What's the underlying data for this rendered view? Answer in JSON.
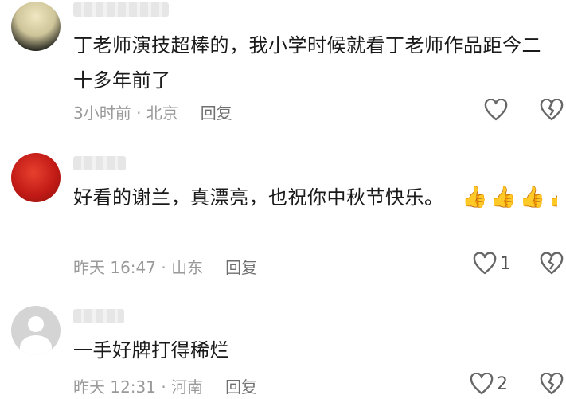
{
  "comments": [
    {
      "text": "丁老师演技超棒的，我小学时候就看丁老师作品距今二十多年前了",
      "time": "3小时前 · 北京",
      "reply_label": "回复",
      "like_count": ""
    },
    {
      "text": "好看的谢兰，真漂亮，也祝你中秋节快乐。",
      "emoji": "👍👍👍👍👍👍",
      "time": "昨天 16:47 · 山东",
      "reply_label": "回复",
      "like_count": "1"
    },
    {
      "text": "一手好牌打得稀烂",
      "time": "昨天 12:31 · 河南",
      "reply_label": "回复",
      "like_count": "2"
    }
  ]
}
